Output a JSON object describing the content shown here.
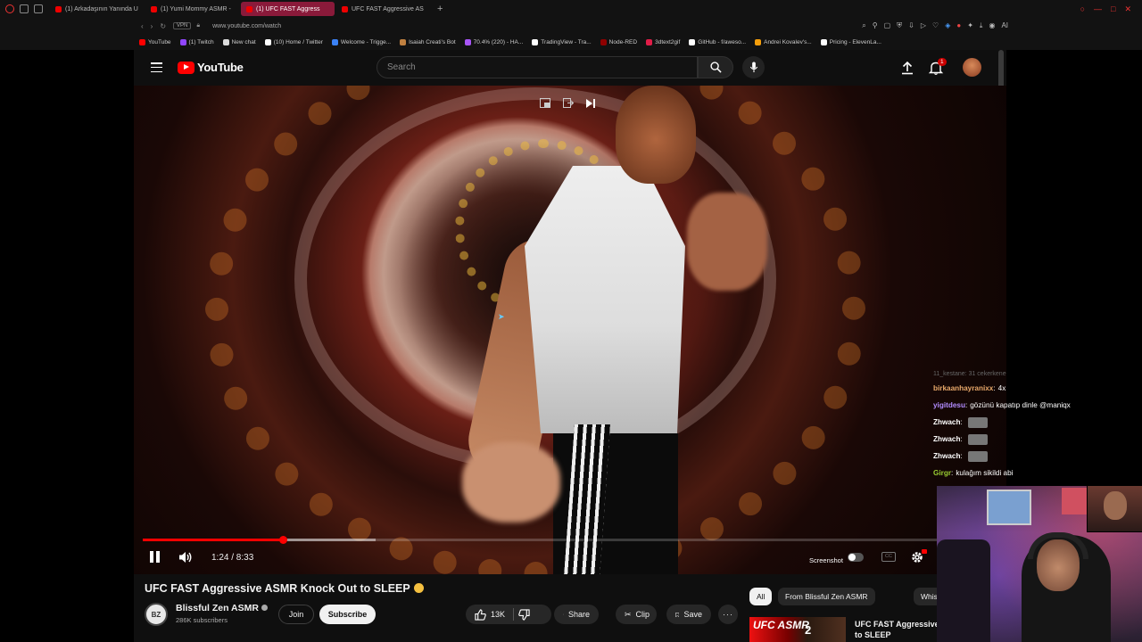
{
  "browser": {
    "tabs": [
      {
        "label": "(1) Arkadaşının Yanında U",
        "active": false
      },
      {
        "label": "(1) Yumi Mommy ASMR -",
        "active": false
      },
      {
        "label": "(1) UFC FAST Aggress",
        "active": true
      },
      {
        "label": "UFC FAST Aggressive AS",
        "active": false
      }
    ],
    "new_tab": "+",
    "vpn_label": "VPN",
    "url": "www.youtube.com/watch",
    "bookmarks": [
      {
        "label": "YouTube",
        "color": "#ff0000"
      },
      {
        "label": "(1) Twitch",
        "color": "#9146ff"
      },
      {
        "label": "New chat",
        "color": "#dddddd"
      },
      {
        "label": "(10) Home / Twitter",
        "color": "#ffffff"
      },
      {
        "label": "Welcome - Trigge...",
        "color": "#3b82f6"
      },
      {
        "label": "Isaiah Creati's Bot",
        "color": "#c08040"
      },
      {
        "label": "70.4% (220) - HA...",
        "color": "#a855f7"
      },
      {
        "label": "TradingView - Tra...",
        "color": "#ffffff"
      },
      {
        "label": "Node-RED",
        "color": "#8f0000"
      },
      {
        "label": "3dtext2gif",
        "color": "#e11d48"
      },
      {
        "label": "GitHub - f/aweso...",
        "color": "#ffffff"
      },
      {
        "label": "Andrei Kovalev's...",
        "color": "#f59e0b"
      },
      {
        "label": "Pricing - ElevenLa...",
        "color": "#ffffff"
      }
    ]
  },
  "header": {
    "logo_text": "YouTube",
    "search_placeholder": "Search",
    "notification_count": "1"
  },
  "player": {
    "current_time": "1:24",
    "duration": "8:33",
    "time_display": "1:24 / 8:33",
    "progress_fraction": 0.164,
    "buffered_fraction": 0.272,
    "screenshot_label": "Screenshot",
    "cc_label": "CC"
  },
  "video": {
    "title": "UFC FAST Aggressive ASMR Knock Out to SLEEP",
    "channel_initials": "BZ",
    "channel_name": "Blissful Zen ASMR",
    "subscribers": "286K subscribers",
    "join_label": "Join",
    "subscribe_label": "Subscribe",
    "likes": "13K",
    "share_label": "Share",
    "clip_label": "Clip",
    "save_label": "Save",
    "more_label": "···"
  },
  "chips": [
    {
      "label": "All",
      "active": true
    },
    {
      "label": "From Blissful Zen ASMR",
      "active": false
    },
    {
      "label": "Whispering",
      "active": false
    }
  ],
  "recommendation": {
    "thumb_text_1": "UFC ASMR",
    "thumb_text_2": "2",
    "title": "UFC FAST Aggressive Knock Out to SLEEP"
  },
  "chat": {
    "faded_line": "11_kestane: 31 cekerkene",
    "messages": [
      {
        "user": "birkaanhayranixx",
        "sep": ":",
        "text": "4x",
        "color": "#e8a86a",
        "emote": false
      },
      {
        "user": "yigitdesu",
        "sep": ":",
        "text": "gözünü kapatıp dinle @maniqx",
        "color": "#b28cff",
        "emote": false
      },
      {
        "user": "Zhwach",
        "sep": ":",
        "text": "",
        "color": "#ffffff",
        "emote": true
      },
      {
        "user": "Zhwach",
        "sep": ":",
        "text": "",
        "color": "#ffffff",
        "emote": true
      },
      {
        "user": "Zhwach",
        "sep": ":",
        "text": "",
        "color": "#ffffff",
        "emote": true
      },
      {
        "user": "Girgr",
        "sep": ":",
        "text": "kulağım sikildi abi",
        "color": "#9acd32",
        "emote": false
      }
    ]
  }
}
